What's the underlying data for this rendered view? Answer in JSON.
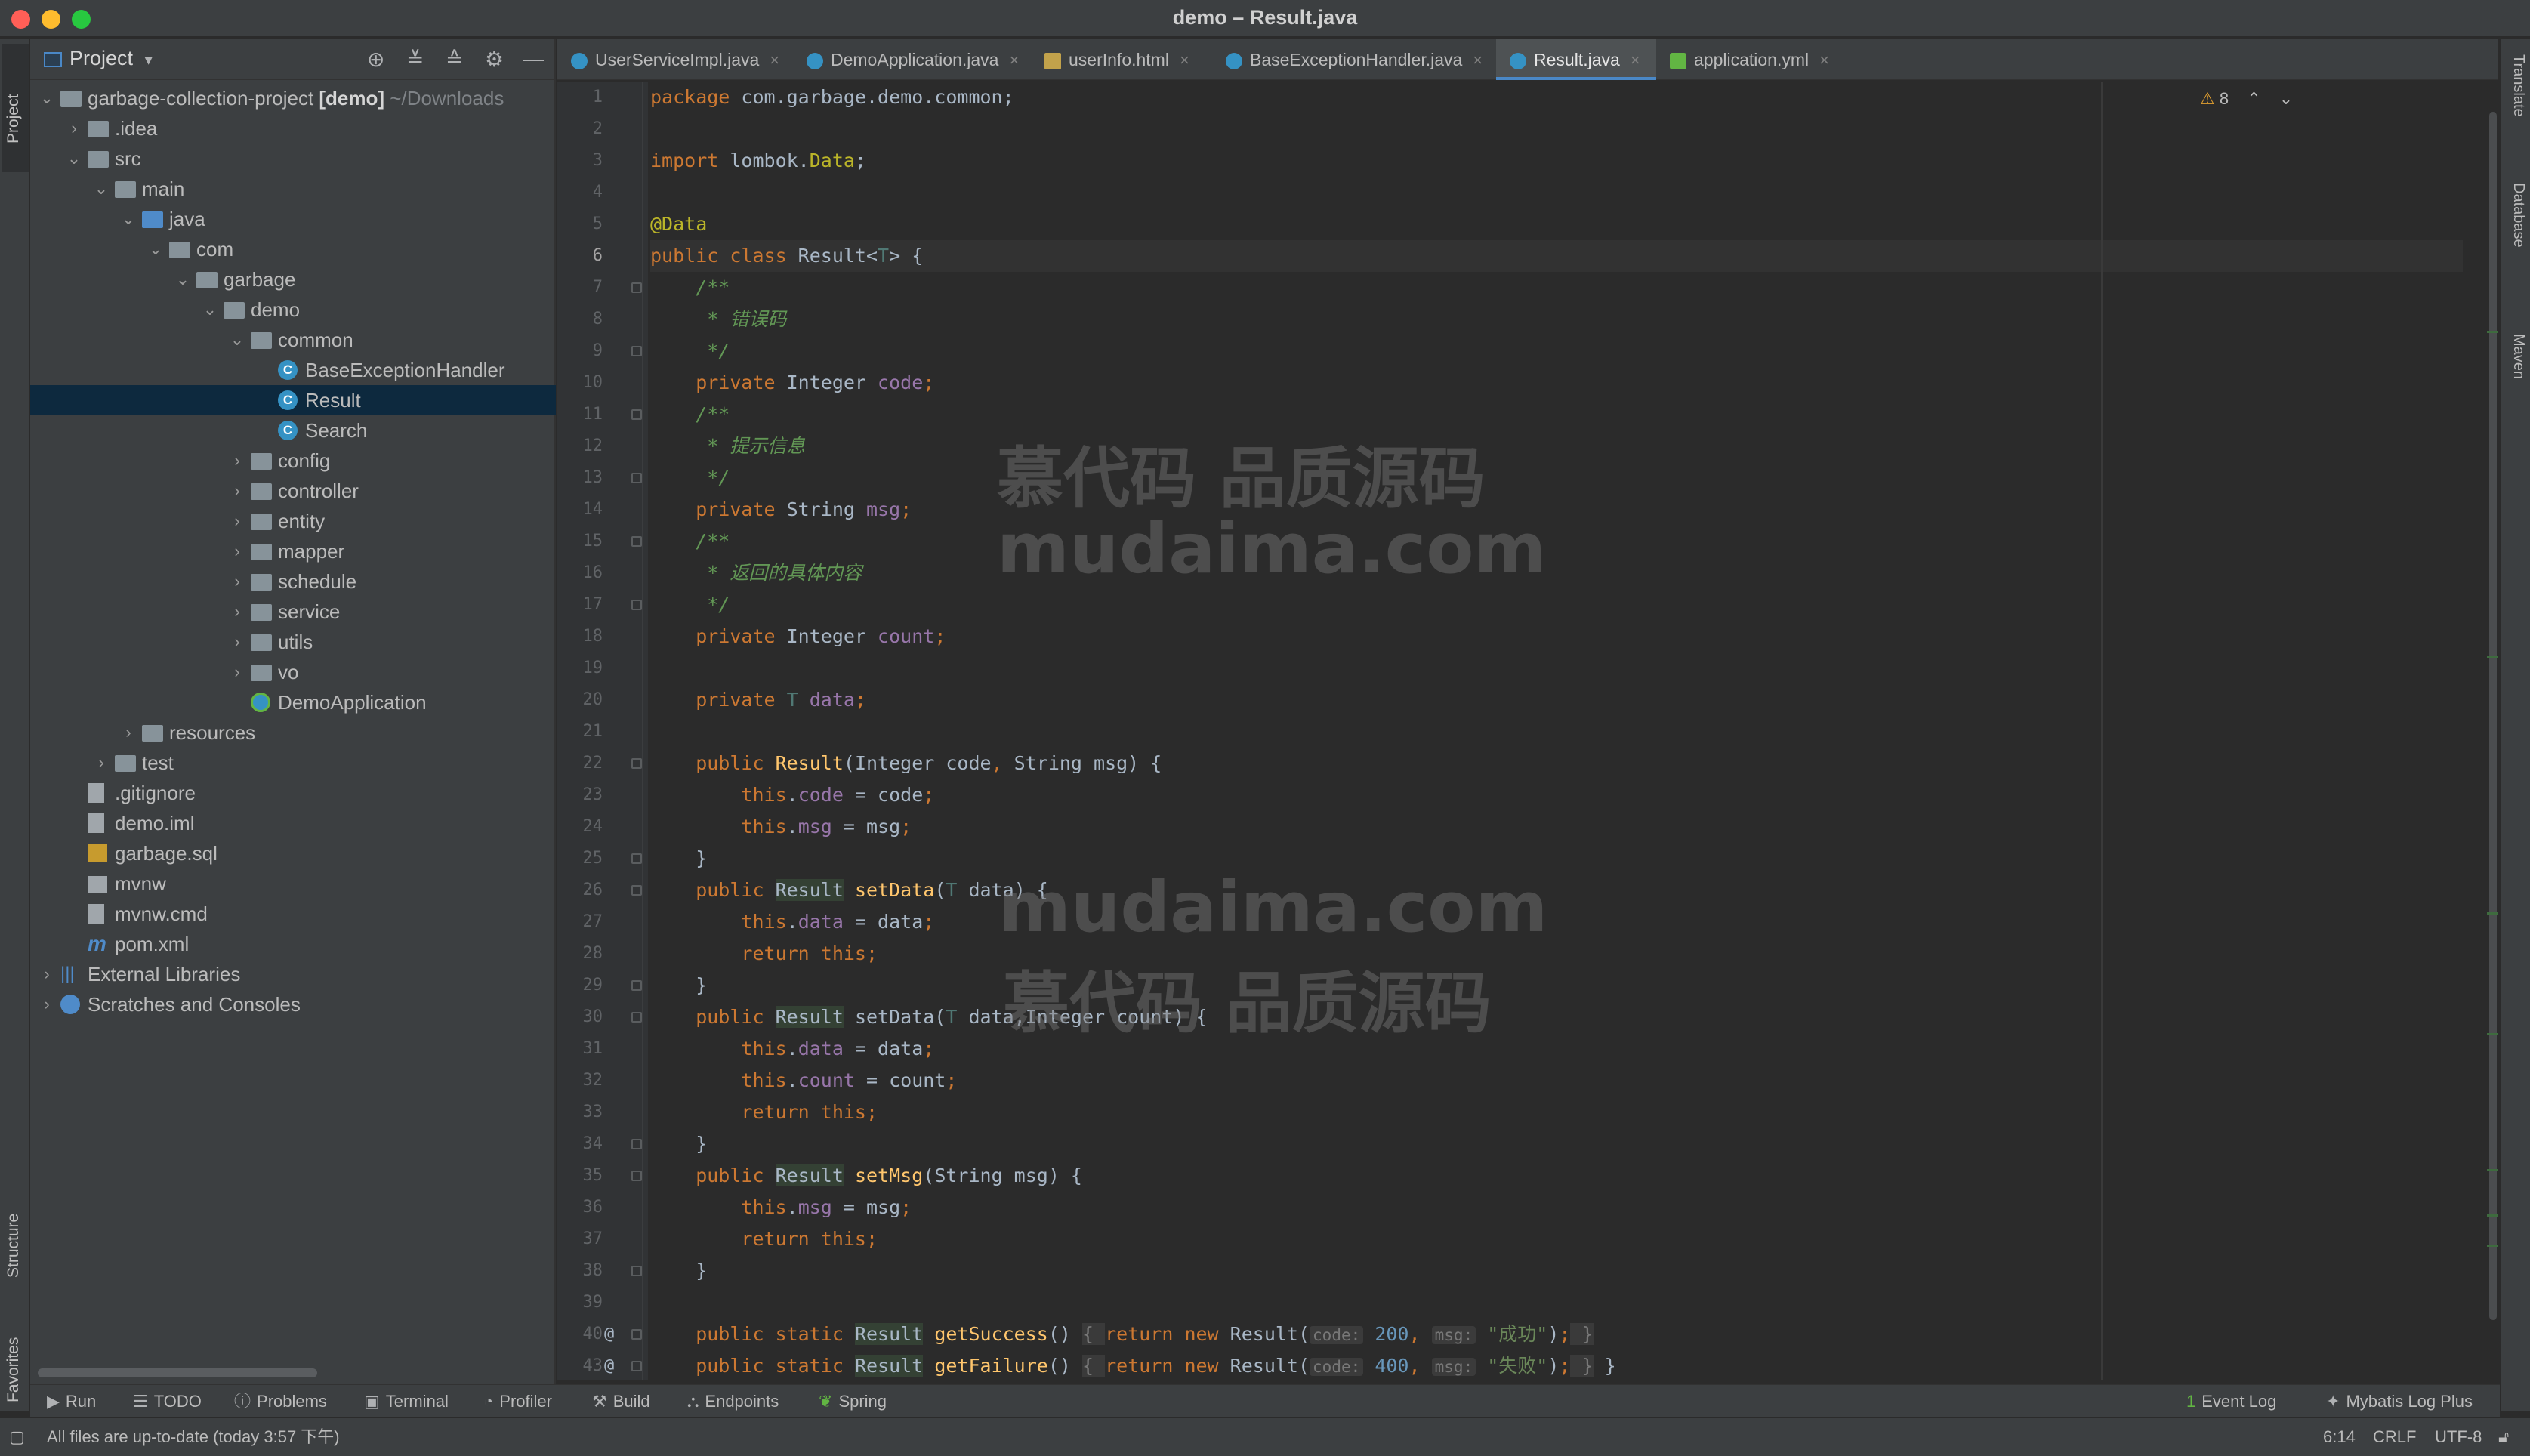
{
  "window": {
    "title": "demo – Result.java"
  },
  "left_strip": {
    "project": "Project",
    "structure": "Structure",
    "favorites": "Favorites"
  },
  "right_strip": {
    "translate": "Translate",
    "database": "Database",
    "maven": "Maven"
  },
  "project_panel": {
    "title": "Project",
    "tree": [
      {
        "depth": 0,
        "chevron": "down",
        "icon": "folder",
        "name": "garbage-collection-project",
        "bold_suffix": "[demo]",
        "muted_suffix": "~/Downloads"
      },
      {
        "depth": 1,
        "chevron": "right",
        "icon": "folder",
        "name": ".idea"
      },
      {
        "depth": 1,
        "chevron": "down",
        "icon": "folder",
        "name": "src"
      },
      {
        "depth": 2,
        "chevron": "down",
        "icon": "folder",
        "name": "main"
      },
      {
        "depth": 3,
        "chevron": "down",
        "icon": "folder-blue",
        "name": "java"
      },
      {
        "depth": 4,
        "chevron": "down",
        "icon": "folder",
        "name": "com"
      },
      {
        "depth": 5,
        "chevron": "down",
        "icon": "folder",
        "name": "garbage"
      },
      {
        "depth": 6,
        "chevron": "down",
        "icon": "folder",
        "name": "demo"
      },
      {
        "depth": 7,
        "chevron": "down",
        "icon": "folder",
        "name": "common"
      },
      {
        "depth": 8,
        "chevron": "",
        "icon": "class",
        "name": "BaseExceptionHandler"
      },
      {
        "depth": 8,
        "chevron": "",
        "icon": "class",
        "name": "Result",
        "selected": true
      },
      {
        "depth": 8,
        "chevron": "",
        "icon": "class",
        "name": "Search"
      },
      {
        "depth": 7,
        "chevron": "right",
        "icon": "folder",
        "name": "config"
      },
      {
        "depth": 7,
        "chevron": "right",
        "icon": "folder",
        "name": "controller"
      },
      {
        "depth": 7,
        "chevron": "right",
        "icon": "folder",
        "name": "entity"
      },
      {
        "depth": 7,
        "chevron": "right",
        "icon": "folder",
        "name": "mapper"
      },
      {
        "depth": 7,
        "chevron": "right",
        "icon": "folder",
        "name": "schedule"
      },
      {
        "depth": 7,
        "chevron": "right",
        "icon": "folder",
        "name": "service"
      },
      {
        "depth": 7,
        "chevron": "right",
        "icon": "folder",
        "name": "utils"
      },
      {
        "depth": 7,
        "chevron": "right",
        "icon": "folder",
        "name": "vo"
      },
      {
        "depth": 7,
        "chevron": "",
        "icon": "app",
        "name": "DemoApplication"
      },
      {
        "depth": 3,
        "chevron": "right",
        "icon": "folder",
        "name": "resources"
      },
      {
        "depth": 2,
        "chevron": "right",
        "icon": "folder",
        "name": "test"
      },
      {
        "depth": 1,
        "chevron": "",
        "icon": "file",
        "name": ".gitignore"
      },
      {
        "depth": 1,
        "chevron": "",
        "icon": "file",
        "name": "demo.iml"
      },
      {
        "depth": 1,
        "chevron": "",
        "icon": "sql",
        "name": "garbage.sql"
      },
      {
        "depth": 1,
        "chevron": "",
        "icon": "term",
        "name": "mvnw"
      },
      {
        "depth": 1,
        "chevron": "",
        "icon": "file",
        "name": "mvnw.cmd"
      },
      {
        "depth": 1,
        "chevron": "",
        "icon": "maven",
        "name": "pom.xml"
      },
      {
        "depth": 0,
        "chevron": "right",
        "icon": "lib",
        "name": "External Libraries"
      },
      {
        "depth": 0,
        "chevron": "right",
        "icon": "scratch",
        "name": "Scratches and Consoles"
      }
    ]
  },
  "editor_tabs": [
    {
      "label": "UserServiceImpl.java",
      "icon": "class"
    },
    {
      "label": "DemoApplication.java",
      "icon": "app"
    },
    {
      "label": "userInfo.html",
      "icon": "html"
    },
    {
      "label": "BaseExceptionHandler.java",
      "icon": "class"
    },
    {
      "label": "Result.java",
      "icon": "class",
      "active": true
    },
    {
      "label": "application.yml",
      "icon": "yml"
    }
  ],
  "editor": {
    "inspection_count": "8",
    "current_line": 6,
    "lines": [
      [
        [
          "kw",
          "package "
        ],
        [
          "",
          "com.garbage.demo.common;"
        ]
      ],
      [],
      [
        [
          "kw",
          "import "
        ],
        [
          "",
          "lombok."
        ],
        [
          "ann",
          "Data"
        ],
        [
          "",
          ";"
        ]
      ],
      [],
      [
        [
          "ann",
          "@Data"
        ]
      ],
      [
        [
          "kw",
          "public class "
        ],
        [
          "",
          "Result<"
        ],
        [
          "tp",
          "T"
        ],
        [
          "",
          "> {"
        ]
      ],
      [
        [
          "cmt",
          "    /**"
        ]
      ],
      [
        [
          "cmt",
          "     * 错误码"
        ]
      ],
      [
        [
          "cmt",
          "     */"
        ]
      ],
      [
        [
          "kw",
          "    private "
        ],
        [
          "",
          "Integer "
        ],
        [
          "fld",
          "code"
        ],
        [
          "kw",
          ";"
        ]
      ],
      [
        [
          "cmt",
          "    /**"
        ]
      ],
      [
        [
          "cmt",
          "     * 提示信息"
        ]
      ],
      [
        [
          "cmt",
          "     */"
        ]
      ],
      [
        [
          "kw",
          "    private "
        ],
        [
          "",
          "String "
        ],
        [
          "fld",
          "msg"
        ],
        [
          "kw",
          ";"
        ]
      ],
      [
        [
          "cmt",
          "    /**"
        ]
      ],
      [
        [
          "cmt",
          "     * 返回的具体内容"
        ]
      ],
      [
        [
          "cmt",
          "     */"
        ]
      ],
      [
        [
          "kw",
          "    private "
        ],
        [
          "",
          "Integer "
        ],
        [
          "fld",
          "count"
        ],
        [
          "kw",
          ";"
        ]
      ],
      [],
      [
        [
          "kw",
          "    private "
        ],
        [
          "tp",
          "T "
        ],
        [
          "fld",
          "data"
        ],
        [
          "kw",
          ";"
        ]
      ],
      [],
      [
        [
          "kw",
          "    public "
        ],
        [
          "fn",
          "Result"
        ],
        [
          "",
          "(Integer code"
        ],
        [
          "kw",
          ", "
        ],
        [
          "",
          "String msg) {"
        ]
      ],
      [
        [
          "kw",
          "        this"
        ],
        [
          "",
          "."
        ],
        [
          "fld",
          "code"
        ],
        [
          "",
          " = code"
        ],
        [
          "kw",
          ";"
        ]
      ],
      [
        [
          "kw",
          "        this"
        ],
        [
          "",
          "."
        ],
        [
          "fld",
          "msg"
        ],
        [
          "",
          " = msg"
        ],
        [
          "kw",
          ";"
        ]
      ],
      [
        [
          "",
          "    }"
        ]
      ],
      [
        [
          "kw",
          "    public "
        ],
        [
          "hl",
          "Result"
        ],
        [
          "",
          " "
        ],
        [
          "fn",
          "setData"
        ],
        [
          "",
          "("
        ],
        [
          "tp",
          "T "
        ],
        [
          "",
          "data) {"
        ]
      ],
      [
        [
          "kw",
          "        this"
        ],
        [
          "",
          "."
        ],
        [
          "fld",
          "data"
        ],
        [
          "",
          " = data"
        ],
        [
          "kw",
          ";"
        ]
      ],
      [
        [
          "kw",
          "        return this"
        ],
        [
          "kw",
          ";"
        ]
      ],
      [
        [
          "",
          "    }"
        ]
      ],
      [
        [
          "kw",
          "    public "
        ],
        [
          "hl",
          "Result"
        ],
        [
          "",
          " setData("
        ],
        [
          "tp",
          "T "
        ],
        [
          "",
          "data,Integer count) {"
        ]
      ],
      [
        [
          "kw",
          "        this"
        ],
        [
          "",
          "."
        ],
        [
          "fld",
          "data"
        ],
        [
          "",
          " = data"
        ],
        [
          "kw",
          ";"
        ]
      ],
      [
        [
          "kw",
          "        this"
        ],
        [
          "",
          "."
        ],
        [
          "fld",
          "count"
        ],
        [
          "",
          " = count"
        ],
        [
          "kw",
          ";"
        ]
      ],
      [
        [
          "kw",
          "        return this"
        ],
        [
          "kw",
          ";"
        ]
      ],
      [
        [
          "",
          "    }"
        ]
      ],
      [
        [
          "kw",
          "    public "
        ],
        [
          "hl",
          "Result"
        ],
        [
          "",
          " "
        ],
        [
          "fn",
          "setMsg"
        ],
        [
          "",
          "(String msg) {"
        ]
      ],
      [
        [
          "kw",
          "        this"
        ],
        [
          "",
          "."
        ],
        [
          "fld",
          "msg"
        ],
        [
          "",
          " = msg"
        ],
        [
          "kw",
          ";"
        ]
      ],
      [
        [
          "kw",
          "        return this"
        ],
        [
          "kw",
          ";"
        ]
      ],
      [
        [
          "",
          "    }"
        ]
      ],
      [],
      [
        [
          "kw",
          "    public static "
        ],
        [
          "hl",
          "Result"
        ],
        [
          "",
          " "
        ],
        [
          "fn",
          "getSuccess"
        ],
        [
          "",
          "() "
        ],
        [
          "fold",
          "{ "
        ],
        [
          "kw",
          "return new "
        ],
        [
          "",
          "Result("
        ],
        [
          "hint",
          "code:"
        ],
        [
          "",
          " "
        ],
        [
          "num",
          "200"
        ],
        [
          "kw",
          ", "
        ],
        [
          "hint",
          "msg:"
        ],
        [
          "",
          " "
        ],
        [
          "str",
          "\"成功\""
        ],
        [
          "",
          ")"
        ],
        [
          "kw",
          ";"
        ],
        [
          "fold",
          " }"
        ]
      ],
      [
        [
          "kw",
          "    public static "
        ],
        [
          "hl",
          "Result"
        ],
        [
          "",
          " "
        ],
        [
          "fn",
          "getFailure"
        ],
        [
          "",
          "() "
        ],
        [
          "fold",
          "{ "
        ],
        [
          "kw",
          "return new "
        ],
        [
          "",
          "Result("
        ],
        [
          "hint",
          "code:"
        ],
        [
          "",
          " "
        ],
        [
          "num",
          "400"
        ],
        [
          "kw",
          ", "
        ],
        [
          "hint",
          "msg:"
        ],
        [
          "",
          " "
        ],
        [
          "str",
          "\"失败\""
        ],
        [
          "",
          ")"
        ],
        [
          "kw",
          ";"
        ],
        [
          "fold",
          " }"
        ],
        [
          "",
          " }"
        ]
      ]
    ],
    "line_numbers": [
      "1",
      "2",
      "3",
      "4",
      "5",
      "6",
      "7",
      "8",
      "9",
      "10",
      "11",
      "12",
      "13",
      "14",
      "15",
      "16",
      "17",
      "18",
      "19",
      "20",
      "21",
      "22",
      "23",
      "24",
      "25",
      "26",
      "27",
      "28",
      "29",
      "30",
      "31",
      "32",
      "33",
      "34",
      "35",
      "36",
      "37",
      "38",
      "39",
      "40",
      "43"
    ],
    "at_markers": [
      "40",
      "43"
    ]
  },
  "watermark": {
    "line1": "慕代码 品质源码",
    "line2": "mudaima.com",
    "line3": "mudaima.com",
    "line4": "慕代码 品质源码"
  },
  "bottom_tools": {
    "run": "Run",
    "todo": "TODO",
    "problems": "Problems",
    "terminal": "Terminal",
    "profiler": "Profiler",
    "build": "Build",
    "endpoints": "Endpoints",
    "spring": "Spring",
    "event_log": "Event Log",
    "event_log_count": "1",
    "mybatis": "Mybatis Log Plus"
  },
  "status": {
    "message": "All files are up-to-date (today 3:57 下午)",
    "position": "6:14",
    "line_sep": "CRLF",
    "encoding": "UTF-8"
  }
}
